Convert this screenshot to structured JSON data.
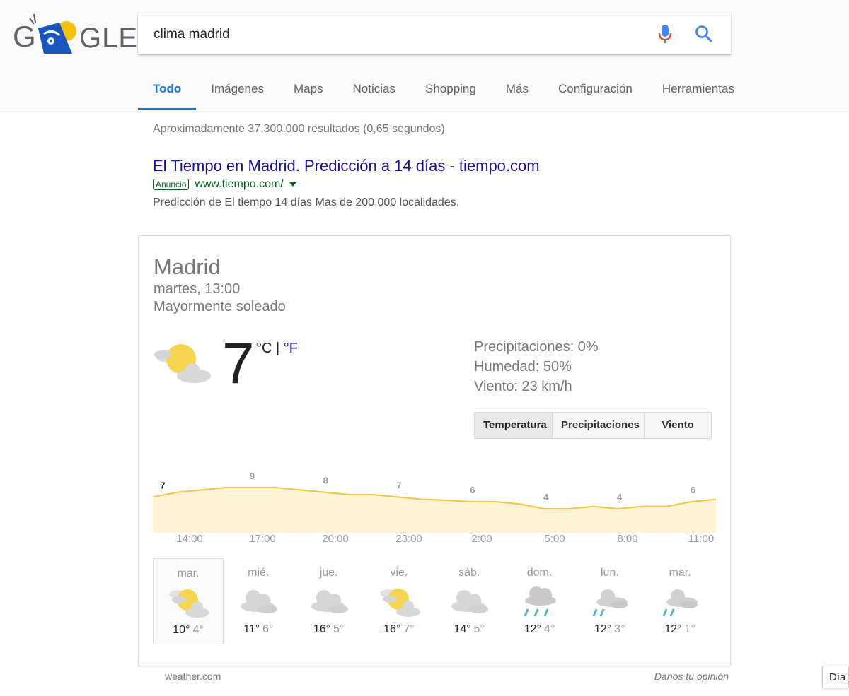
{
  "logo": {
    "text": "GLE",
    "colors": {
      "blue": "#1a56c2",
      "yellow": "#f4c20d",
      "grey": "#5f6368"
    }
  },
  "search": {
    "query": "clima madrid",
    "mic_icon": "mic-icon",
    "search_icon": "search-icon"
  },
  "tabs": [
    {
      "label": "Todo",
      "active": true
    },
    {
      "label": "Imágenes"
    },
    {
      "label": "Maps"
    },
    {
      "label": "Noticias"
    },
    {
      "label": "Shopping"
    },
    {
      "label": "Más"
    },
    {
      "label": "Configuración"
    },
    {
      "label": "Herramientas"
    }
  ],
  "stats": "Aproximadamente 37.300.000 resultados (0,65 segundos)",
  "ad": {
    "title": "El Tiempo en Madrid. Predicción a 14 días - tiempo.com",
    "badge": "Anuncio",
    "url": "www.tiempo.com/",
    "description": "Predicción de El tiempo 14 días Mas de 200.000 localidades."
  },
  "weather": {
    "city": "Madrid",
    "datetime": "martes, 13:00",
    "condition": "Mayormente soleado",
    "current_icon": "partly-sunny-icon",
    "temperature": "7",
    "unit_c": "°C",
    "unit_sep": " | ",
    "unit_f": "°F",
    "precipitation": "Precipitaciones: 0%",
    "humidity": "Humedad: 50%",
    "wind": "Viento: 23 km/h",
    "chart_tabs": [
      {
        "label": "Temperatura",
        "active": true
      },
      {
        "label": "Precipitaciones"
      },
      {
        "label": "Viento"
      }
    ],
    "accent_line": "#f4c542",
    "accent_fill": "#fdf3d5",
    "times": [
      "14:00",
      "17:00",
      "20:00",
      "23:00",
      "2:00",
      "5:00",
      "8:00",
      "11:00"
    ],
    "days": [
      {
        "name": "mar.",
        "high": "10°",
        "low": "4°",
        "icon": "partly-sunny-icon",
        "selected": true
      },
      {
        "name": "mié.",
        "high": "11°",
        "low": "6°",
        "icon": "cloudy-icon"
      },
      {
        "name": "jue.",
        "high": "16°",
        "low": "5°",
        "icon": "cloudy-icon"
      },
      {
        "name": "vie.",
        "high": "16°",
        "low": "7°",
        "icon": "partly-sunny-icon"
      },
      {
        "name": "sáb.",
        "high": "14°",
        "low": "5°",
        "icon": "cloudy-icon"
      },
      {
        "name": "dom.",
        "high": "12°",
        "low": "4°",
        "icon": "rain-icon"
      },
      {
        "name": "lun.",
        "high": "12°",
        "low": "3°",
        "icon": "showers-icon"
      },
      {
        "name": "mar.",
        "high": "12°",
        "low": "1°",
        "icon": "showers-icon"
      }
    ],
    "source": "weather.com",
    "feedback": "Danos tu opinión"
  },
  "chart_data": {
    "type": "area",
    "x": [
      "13:00",
      "14:00",
      "15:00",
      "16:00",
      "17:00",
      "18:00",
      "19:00",
      "20:00",
      "21:00",
      "22:00",
      "23:00",
      "0:00",
      "1:00",
      "2:00",
      "3:00",
      "4:00",
      "5:00",
      "6:00",
      "7:00",
      "8:00",
      "9:00",
      "10:00",
      "11:00",
      "12:00"
    ],
    "series": [
      {
        "values": [
          7,
          8,
          8.5,
          9,
          9,
          9,
          8.5,
          8,
          7.5,
          7.5,
          7,
          6.5,
          6.3,
          6,
          6,
          5.5,
          4.5,
          4.5,
          5,
          4.5,
          5,
          5,
          6,
          6.5
        ]
      }
    ],
    "labels": [
      {
        "x": "13:00",
        "value": "7"
      },
      {
        "x": "17:00",
        "value": "9"
      },
      {
        "x": "20:00",
        "value": "8"
      },
      {
        "x": "23:00",
        "value": "7"
      },
      {
        "x": "2:00",
        "value": "6"
      },
      {
        "x": "5:00",
        "value": "4"
      },
      {
        "x": "8:00",
        "value": "4"
      },
      {
        "x": "11:00",
        "value": "6"
      }
    ],
    "xlabel": "",
    "ylabel": "",
    "ylim": [
      0,
      12
    ],
    "grid": false
  },
  "language_tab": "Día"
}
